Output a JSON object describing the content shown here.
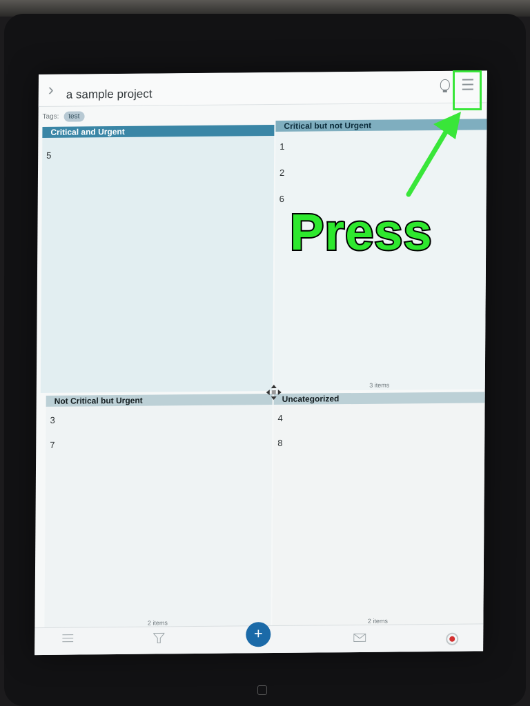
{
  "project": {
    "title": "a sample project",
    "tags_label": "Tags:",
    "tag": "test"
  },
  "quadrants": [
    {
      "title": "Critical and Urgent",
      "items": [
        "5"
      ],
      "count": ""
    },
    {
      "title": "Critical but not Urgent",
      "items": [
        "1",
        "2",
        "6"
      ],
      "count": "3 items"
    },
    {
      "title": "Not Critical but Urgent",
      "items": [
        "3",
        "7"
      ],
      "count": "2 items"
    },
    {
      "title": "Uncategorized",
      "items": [
        "4",
        "8"
      ],
      "count": "2 items"
    }
  ],
  "toolbar": {
    "add_label": "+"
  },
  "annotation": {
    "text": "Press",
    "color": "#39e639"
  },
  "icons": [
    "chevron-right-icon",
    "lightbulb-icon",
    "hamburger-menu-icon",
    "list-icon",
    "filter-icon",
    "add-icon",
    "mail-icon",
    "record-icon",
    "move-icon"
  ]
}
